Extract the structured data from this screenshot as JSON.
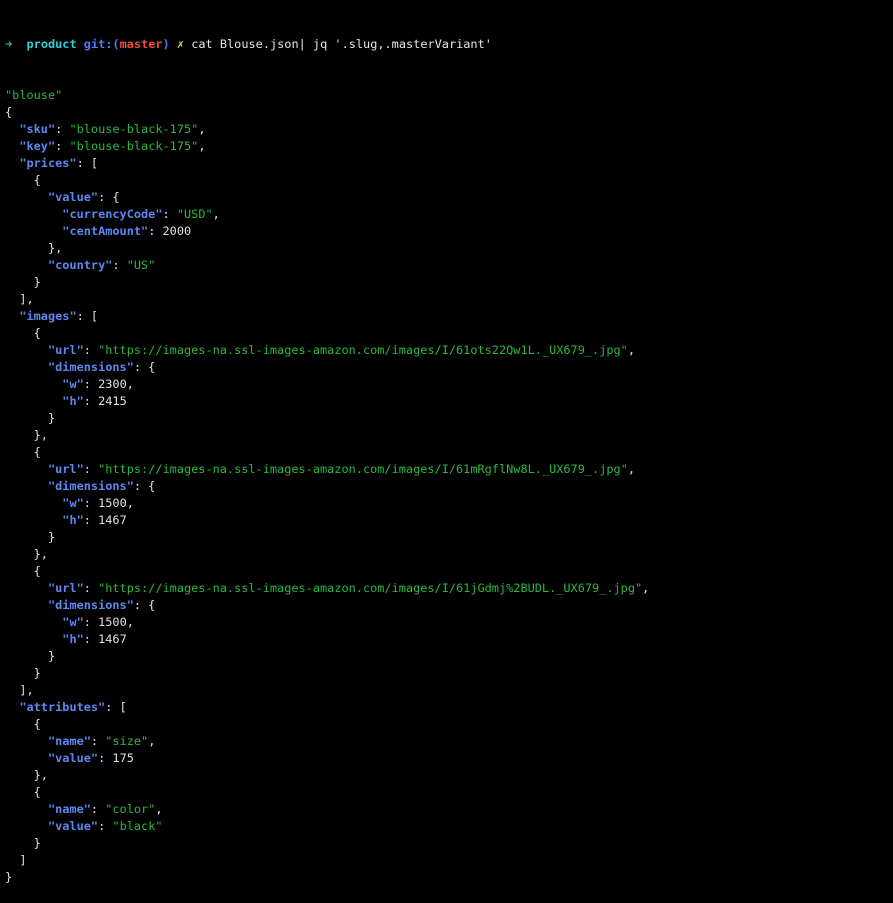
{
  "terminal": {
    "prompt": {
      "arrow": "➜",
      "directory": "product",
      "git_label": "git:(",
      "branch": "master",
      "git_close": ")",
      "dirty_marker": "✗",
      "command": "cat Blouse.json| jq '.slug,.masterVariant'"
    },
    "lines": [
      [
        {
          "t": "s",
          "v": "\"blouse\""
        }
      ],
      [
        {
          "t": "p",
          "v": "{"
        }
      ],
      [
        {
          "t": "p",
          "v": "  "
        },
        {
          "t": "k",
          "v": "\"sku\""
        },
        {
          "t": "p",
          "v": ": "
        },
        {
          "t": "s",
          "v": "\"blouse-black-175\""
        },
        {
          "t": "p",
          "v": ","
        }
      ],
      [
        {
          "t": "p",
          "v": "  "
        },
        {
          "t": "k",
          "v": "\"key\""
        },
        {
          "t": "p",
          "v": ": "
        },
        {
          "t": "s",
          "v": "\"blouse-black-175\""
        },
        {
          "t": "p",
          "v": ","
        }
      ],
      [
        {
          "t": "p",
          "v": "  "
        },
        {
          "t": "k",
          "v": "\"prices\""
        },
        {
          "t": "p",
          "v": ": ["
        }
      ],
      [
        {
          "t": "p",
          "v": "    {"
        }
      ],
      [
        {
          "t": "p",
          "v": "      "
        },
        {
          "t": "k",
          "v": "\"value\""
        },
        {
          "t": "p",
          "v": ": {"
        }
      ],
      [
        {
          "t": "p",
          "v": "        "
        },
        {
          "t": "k",
          "v": "\"currencyCode\""
        },
        {
          "t": "p",
          "v": ": "
        },
        {
          "t": "s",
          "v": "\"USD\""
        },
        {
          "t": "p",
          "v": ","
        }
      ],
      [
        {
          "t": "p",
          "v": "        "
        },
        {
          "t": "k",
          "v": "\"centAmount\""
        },
        {
          "t": "p",
          "v": ": "
        },
        {
          "t": "n",
          "v": "2000"
        }
      ],
      [
        {
          "t": "p",
          "v": "      },"
        }
      ],
      [
        {
          "t": "p",
          "v": "      "
        },
        {
          "t": "k",
          "v": "\"country\""
        },
        {
          "t": "p",
          "v": ": "
        },
        {
          "t": "s",
          "v": "\"US\""
        }
      ],
      [
        {
          "t": "p",
          "v": "    }"
        }
      ],
      [
        {
          "t": "p",
          "v": "  ],"
        }
      ],
      [
        {
          "t": "p",
          "v": "  "
        },
        {
          "t": "k",
          "v": "\"images\""
        },
        {
          "t": "p",
          "v": ": ["
        }
      ],
      [
        {
          "t": "p",
          "v": "    {"
        }
      ],
      [
        {
          "t": "p",
          "v": "      "
        },
        {
          "t": "k",
          "v": "\"url\""
        },
        {
          "t": "p",
          "v": ": "
        },
        {
          "t": "s",
          "v": "\"https://images-na.ssl-images-amazon.com/images/I/61ots22Qw1L._UX679_.jpg\""
        },
        {
          "t": "p",
          "v": ","
        }
      ],
      [
        {
          "t": "p",
          "v": "      "
        },
        {
          "t": "k",
          "v": "\"dimensions\""
        },
        {
          "t": "p",
          "v": ": {"
        }
      ],
      [
        {
          "t": "p",
          "v": "        "
        },
        {
          "t": "k",
          "v": "\"w\""
        },
        {
          "t": "p",
          "v": ": "
        },
        {
          "t": "n",
          "v": "2300"
        },
        {
          "t": "p",
          "v": ","
        }
      ],
      [
        {
          "t": "p",
          "v": "        "
        },
        {
          "t": "k",
          "v": "\"h\""
        },
        {
          "t": "p",
          "v": ": "
        },
        {
          "t": "n",
          "v": "2415"
        }
      ],
      [
        {
          "t": "p",
          "v": "      }"
        }
      ],
      [
        {
          "t": "p",
          "v": "    },"
        }
      ],
      [
        {
          "t": "p",
          "v": "    {"
        }
      ],
      [
        {
          "t": "p",
          "v": "      "
        },
        {
          "t": "k",
          "v": "\"url\""
        },
        {
          "t": "p",
          "v": ": "
        },
        {
          "t": "s",
          "v": "\"https://images-na.ssl-images-amazon.com/images/I/61mRgflNw8L._UX679_.jpg\""
        },
        {
          "t": "p",
          "v": ","
        }
      ],
      [
        {
          "t": "p",
          "v": "      "
        },
        {
          "t": "k",
          "v": "\"dimensions\""
        },
        {
          "t": "p",
          "v": ": {"
        }
      ],
      [
        {
          "t": "p",
          "v": "        "
        },
        {
          "t": "k",
          "v": "\"w\""
        },
        {
          "t": "p",
          "v": ": "
        },
        {
          "t": "n",
          "v": "1500"
        },
        {
          "t": "p",
          "v": ","
        }
      ],
      [
        {
          "t": "p",
          "v": "        "
        },
        {
          "t": "k",
          "v": "\"h\""
        },
        {
          "t": "p",
          "v": ": "
        },
        {
          "t": "n",
          "v": "1467"
        }
      ],
      [
        {
          "t": "p",
          "v": "      }"
        }
      ],
      [
        {
          "t": "p",
          "v": "    },"
        }
      ],
      [
        {
          "t": "p",
          "v": "    {"
        }
      ],
      [
        {
          "t": "p",
          "v": "      "
        },
        {
          "t": "k",
          "v": "\"url\""
        },
        {
          "t": "p",
          "v": ": "
        },
        {
          "t": "s",
          "v": "\"https://images-na.ssl-images-amazon.com/images/I/61jGdmj%2BUDL._UX679_.jpg\""
        },
        {
          "t": "p",
          "v": ","
        }
      ],
      [
        {
          "t": "p",
          "v": "      "
        },
        {
          "t": "k",
          "v": "\"dimensions\""
        },
        {
          "t": "p",
          "v": ": {"
        }
      ],
      [
        {
          "t": "p",
          "v": "        "
        },
        {
          "t": "k",
          "v": "\"w\""
        },
        {
          "t": "p",
          "v": ": "
        },
        {
          "t": "n",
          "v": "1500"
        },
        {
          "t": "p",
          "v": ","
        }
      ],
      [
        {
          "t": "p",
          "v": "        "
        },
        {
          "t": "k",
          "v": "\"h\""
        },
        {
          "t": "p",
          "v": ": "
        },
        {
          "t": "n",
          "v": "1467"
        }
      ],
      [
        {
          "t": "p",
          "v": "      }"
        }
      ],
      [
        {
          "t": "p",
          "v": "    }"
        }
      ],
      [
        {
          "t": "p",
          "v": "  ],"
        }
      ],
      [
        {
          "t": "p",
          "v": "  "
        },
        {
          "t": "k",
          "v": "\"attributes\""
        },
        {
          "t": "p",
          "v": ": ["
        }
      ],
      [
        {
          "t": "p",
          "v": "    {"
        }
      ],
      [
        {
          "t": "p",
          "v": "      "
        },
        {
          "t": "k",
          "v": "\"name\""
        },
        {
          "t": "p",
          "v": ": "
        },
        {
          "t": "s",
          "v": "\"size\""
        },
        {
          "t": "p",
          "v": ","
        }
      ],
      [
        {
          "t": "p",
          "v": "      "
        },
        {
          "t": "k",
          "v": "\"value\""
        },
        {
          "t": "p",
          "v": ": "
        },
        {
          "t": "n",
          "v": "175"
        }
      ],
      [
        {
          "t": "p",
          "v": "    },"
        }
      ],
      [
        {
          "t": "p",
          "v": "    {"
        }
      ],
      [
        {
          "t": "p",
          "v": "      "
        },
        {
          "t": "k",
          "v": "\"name\""
        },
        {
          "t": "p",
          "v": ": "
        },
        {
          "t": "s",
          "v": "\"color\""
        },
        {
          "t": "p",
          "v": ","
        }
      ],
      [
        {
          "t": "p",
          "v": "      "
        },
        {
          "t": "k",
          "v": "\"value\""
        },
        {
          "t": "p",
          "v": ": "
        },
        {
          "t": "s",
          "v": "\"black\""
        }
      ],
      [
        {
          "t": "p",
          "v": "    }"
        }
      ],
      [
        {
          "t": "p",
          "v": "  ]"
        }
      ],
      [
        {
          "t": "p",
          "v": "}"
        }
      ]
    ]
  }
}
